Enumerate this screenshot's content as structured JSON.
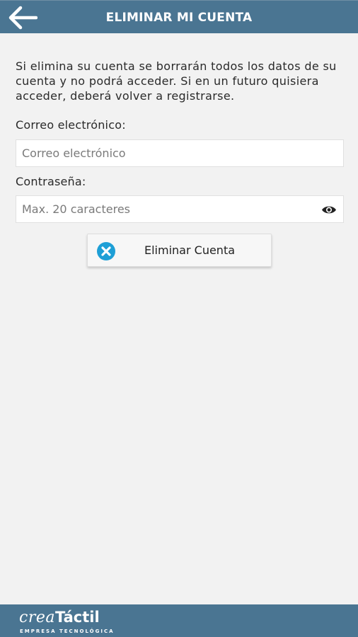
{
  "header": {
    "title": "ELIMINAR MI CUENTA",
    "back_icon": "arrow-left-icon"
  },
  "intro_text": "Si elimina su cuenta se borrarán todos los datos de su cuenta y no podrá acceder. Si en un futuro quisiera acceder, deberá volver a registrarse.",
  "email": {
    "label": "Correo electrónico:",
    "placeholder": "Correo electrónico",
    "value": ""
  },
  "password": {
    "label": "Contraseña:",
    "placeholder": "Max. 20 caracteres",
    "value": "",
    "toggle_icon": "eye-icon"
  },
  "delete_button": {
    "label": "Eliminar Cuenta",
    "icon": "close-circle-icon",
    "icon_color": "#1e9fd6"
  },
  "footer": {
    "brand_crea": "crea",
    "brand_tactil": "Táctil",
    "brand_sub": "EMPRESA TECNOLÓGICA"
  },
  "colors": {
    "bar": "#4a7592",
    "background": "#f2f2f2"
  }
}
